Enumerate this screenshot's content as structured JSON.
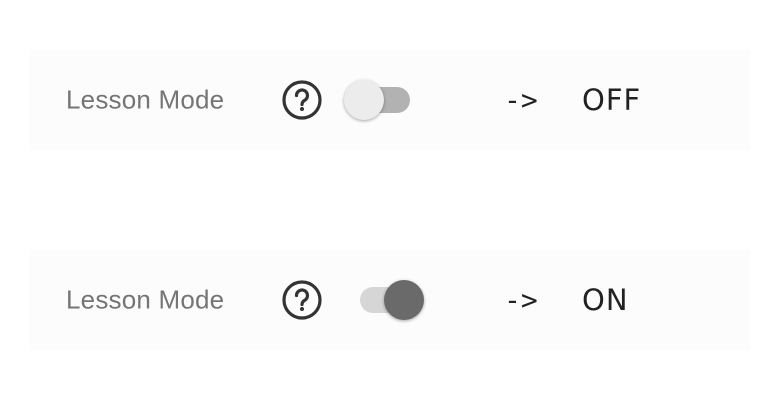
{
  "rows": [
    {
      "label": "Lesson Mode",
      "help_icon": "help-circle-icon",
      "toggle_checked": false,
      "arrow": "->",
      "state": "OFF"
    },
    {
      "label": "Lesson Mode",
      "help_icon": "help-circle-icon",
      "toggle_checked": true,
      "arrow": "->",
      "state": "ON"
    }
  ],
  "colors": {
    "label": "#757575",
    "icon": "#333333",
    "track_off": "#b2b2b2",
    "thumb_off": "#ececec",
    "track_on": "#d6d6d6",
    "thumb_on": "#6a6a6a",
    "text": "#222222"
  }
}
